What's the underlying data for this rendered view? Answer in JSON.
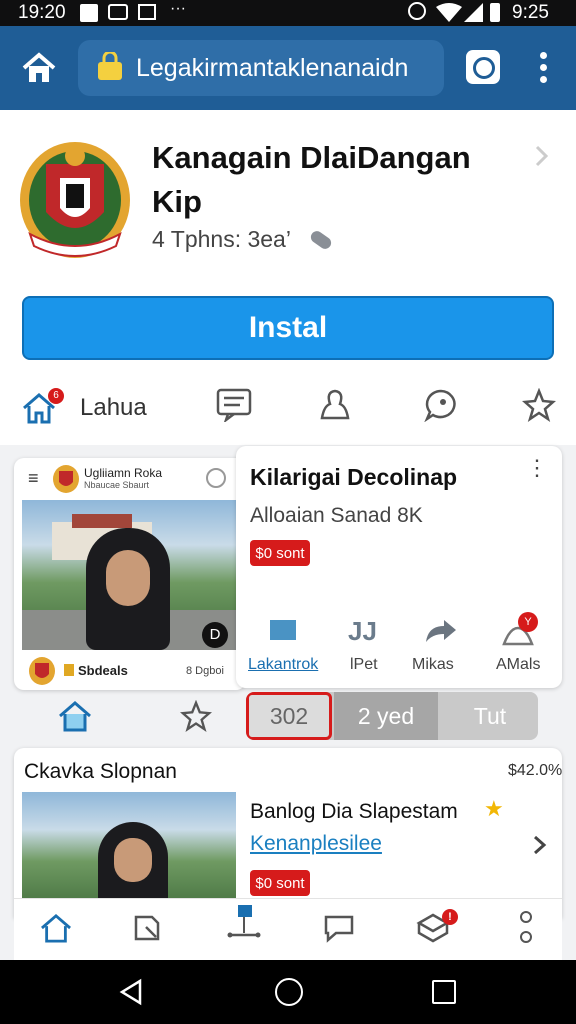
{
  "status_bar": {
    "time_left": "19:20",
    "time_right": "9:25"
  },
  "browser": {
    "url_text": "Legakirmantaklenanaidn"
  },
  "app": {
    "title": "Kanagain DlaiDangan Kip",
    "subtitle": "4 Tphns: 3ea’",
    "install_label": "Instal",
    "tabs": [
      {
        "label": "Lahua",
        "badge": "6"
      }
    ]
  },
  "feed_card": {
    "header_line1": "Ugliiamn Roka",
    "header_line2": "Nbaucae Sbaurt",
    "footer_label": "Sbdeals",
    "footer_meta": "8 Dgboi",
    "video_badge": "D"
  },
  "detail_card": {
    "title": "Kilarigai Decolinap",
    "subtitle": "Alloaian Sanad 8K",
    "badge": "$0 sont",
    "actions": [
      {
        "label": "Lakantrok"
      },
      {
        "label": "lPet"
      },
      {
        "label": "Mikas"
      },
      {
        "label": "AMals",
        "badge": "Y"
      }
    ]
  },
  "segments": [
    "302",
    "2 yed",
    "Tut"
  ],
  "bottom_card": {
    "heading": "Ckavka Slopnan",
    "meta": "$42.0%",
    "title": "Banlog Dia Slapestam",
    "link": "Kenanplesilee",
    "badge": "$0 sont"
  },
  "colors": {
    "brand": "#1f5d96",
    "install": "#1a95ea",
    "badge": "#d61b1b"
  }
}
